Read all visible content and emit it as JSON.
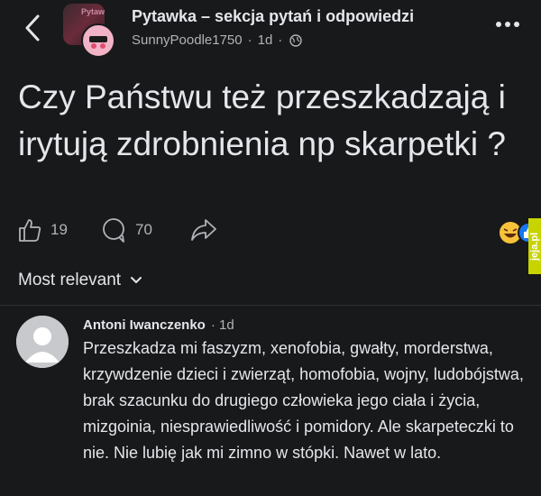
{
  "header": {
    "group_name": "Pytawka – sekcja pytań i odpowiedzi",
    "group_avatar_text": "Pytaw",
    "author": "SunnyPoodle1750",
    "time": "1d",
    "icons": [
      "back-icon",
      "globe-icon",
      "more-icon"
    ]
  },
  "post": {
    "question": "Czy Państwu też przeszkadzają i irytują zdrobnienia np skarpetki ?",
    "likes": "19",
    "comments": "70"
  },
  "watermark": "jeja.pl",
  "sort": {
    "label": "Most relevant"
  },
  "comment": {
    "author": "Antoni Iwanczenko",
    "time": "· 1d",
    "text": "Przeszkadza mi faszyzm, xenofobia, gwałty, morderstwa, krzywdzenie dzieci i zwierząt, homofobia, wojny, ludobójstwa, brak szacunku do drugiego człowieka jego ciała i życia, mizgoinia, niesprawiedliwość i pomidory. Ale skarpeteczki to nie. Nie lubię jak mi zimno w stópki. Nawet w lato."
  },
  "colors": {
    "background": "#18191a",
    "text": "#e4e6eb",
    "secondary": "#b0b3b8",
    "like_blue": "#1877f2",
    "emoji_yellow": "#f7c23a"
  }
}
